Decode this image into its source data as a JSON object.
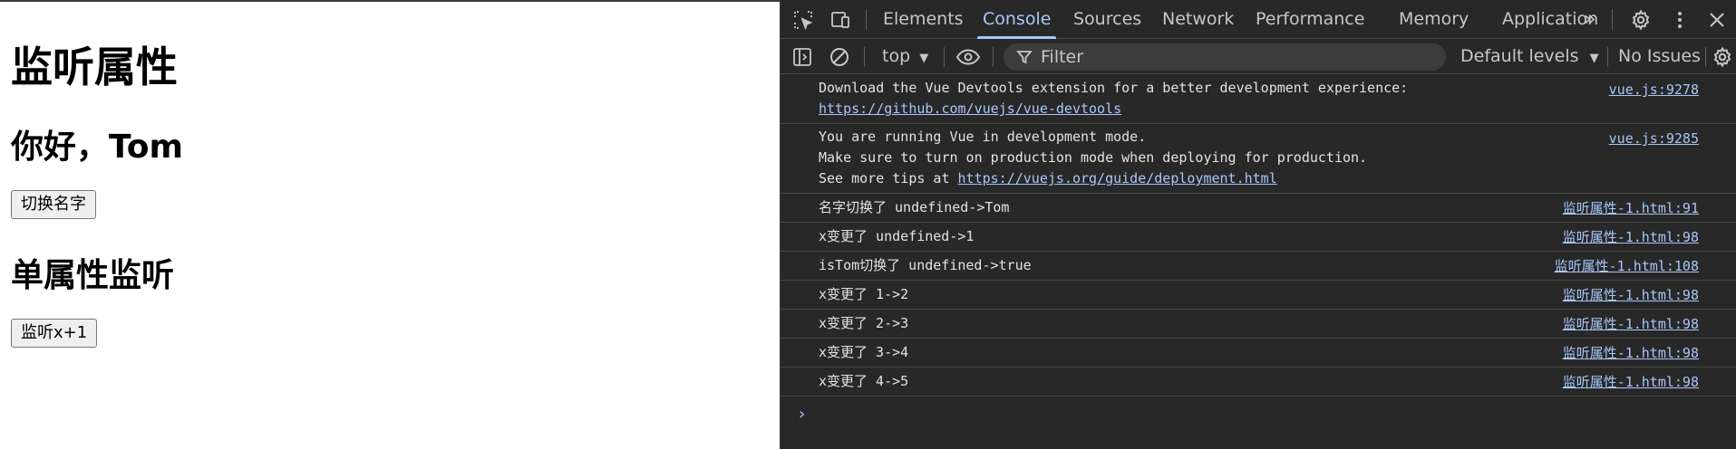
{
  "page": {
    "title": "监听属性",
    "greeting": "你好，Tom",
    "switch_button": "切换名字",
    "section_title": "单属性监听",
    "increment_button": "监听x+1"
  },
  "devtools": {
    "tabs": [
      "Elements",
      "Console",
      "Sources",
      "Network",
      "Performance",
      "Memory",
      "Application"
    ],
    "active_tab": "Console",
    "overflow_label": "»",
    "toolbar": {
      "context": "top",
      "filter_placeholder": "Filter",
      "levels": "Default levels",
      "issues": "No Issues"
    },
    "messages": [
      {
        "lines": [
          "Download the Vue Devtools extension for a better development experience:"
        ],
        "link": "https://github.com/vuejs/vue-devtools",
        "source": "vue.js:9278"
      },
      {
        "lines": [
          "You are running Vue in development mode.",
          "Make sure to turn on production mode when deploying for production."
        ],
        "prefix": "See more tips at ",
        "link": "https://vuejs.org/guide/deployment.html",
        "source": "vue.js:9285"
      },
      {
        "lines": [
          "名字切换了 undefined->Tom"
        ],
        "source": "监听属性-1.html:91"
      },
      {
        "lines": [
          "x变更了 undefined->1"
        ],
        "source": "监听属性-1.html:98"
      },
      {
        "lines": [
          "isTom切换了 undefined->true"
        ],
        "source": "监听属性-1.html:108"
      },
      {
        "lines": [
          "x变更了 1->2"
        ],
        "source": "监听属性-1.html:98"
      },
      {
        "lines": [
          "x变更了 2->3"
        ],
        "source": "监听属性-1.html:98"
      },
      {
        "lines": [
          "x变更了 3->4"
        ],
        "source": "监听属性-1.html:98"
      },
      {
        "lines": [
          "x变更了 4->5"
        ],
        "source": "监听属性-1.html:98"
      }
    ],
    "prompt": "›",
    "colors": {
      "accent": "#a8c7fa",
      "background": "#282828",
      "text": "#e3e3e3"
    }
  }
}
